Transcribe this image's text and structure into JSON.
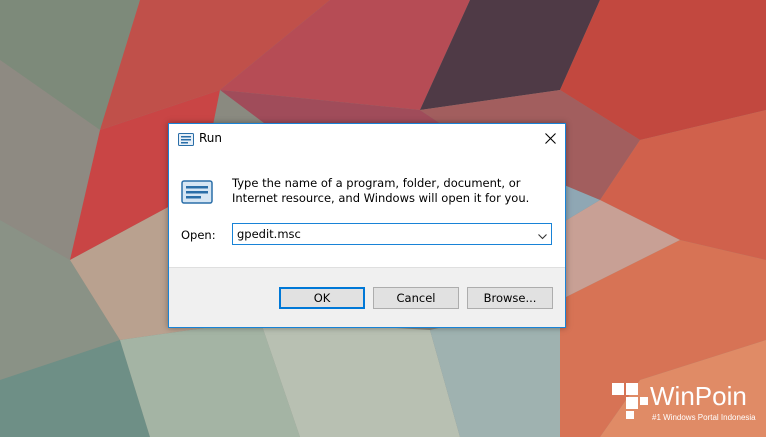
{
  "dialog": {
    "title": "Run",
    "title_icon": "run-icon",
    "close_icon": "close-icon",
    "description": "Type the name of a program, folder, document, or Internet resource, and Windows will open it for you.",
    "open_label": "Open:",
    "open_value": "gpedit.msc",
    "dropdown_icon": "chevron-down-icon",
    "buttons": {
      "ok": "OK",
      "cancel": "Cancel",
      "browse": "Browse..."
    }
  },
  "watermark": {
    "brand": "WinPoin",
    "tagline": "#1 Windows Portal Indonesia"
  },
  "colors": {
    "accent": "#1883d7",
    "footer": "#f0f0f0",
    "button": "#e1e1e1"
  }
}
